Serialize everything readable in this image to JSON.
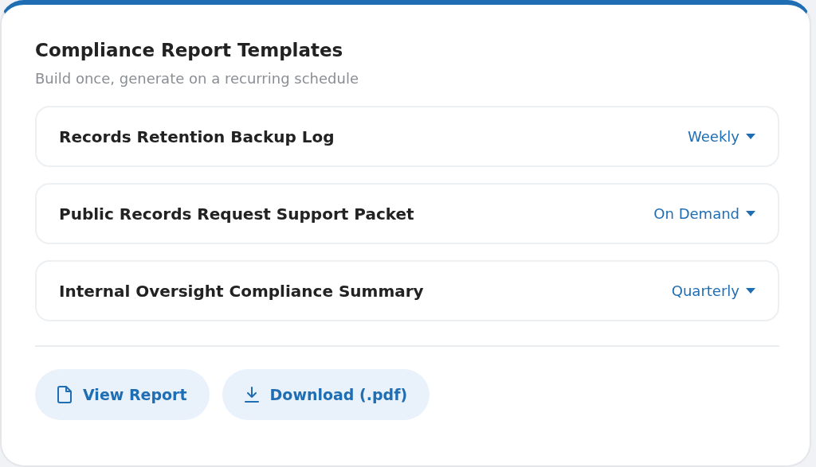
{
  "card": {
    "title": "Compliance Report Templates",
    "subtitle": "Build once, generate on a recurring schedule"
  },
  "templates": [
    {
      "name": "Records Retention Backup Log",
      "schedule": "Weekly"
    },
    {
      "name": "Public Records Request Support Packet",
      "schedule": "On Demand"
    },
    {
      "name": "Internal Oversight Compliance Summary",
      "schedule": "Quarterly"
    }
  ],
  "actions": [
    {
      "kind": "view",
      "label": "View Report"
    },
    {
      "kind": "download",
      "label": "Download (.pdf)"
    }
  ]
}
